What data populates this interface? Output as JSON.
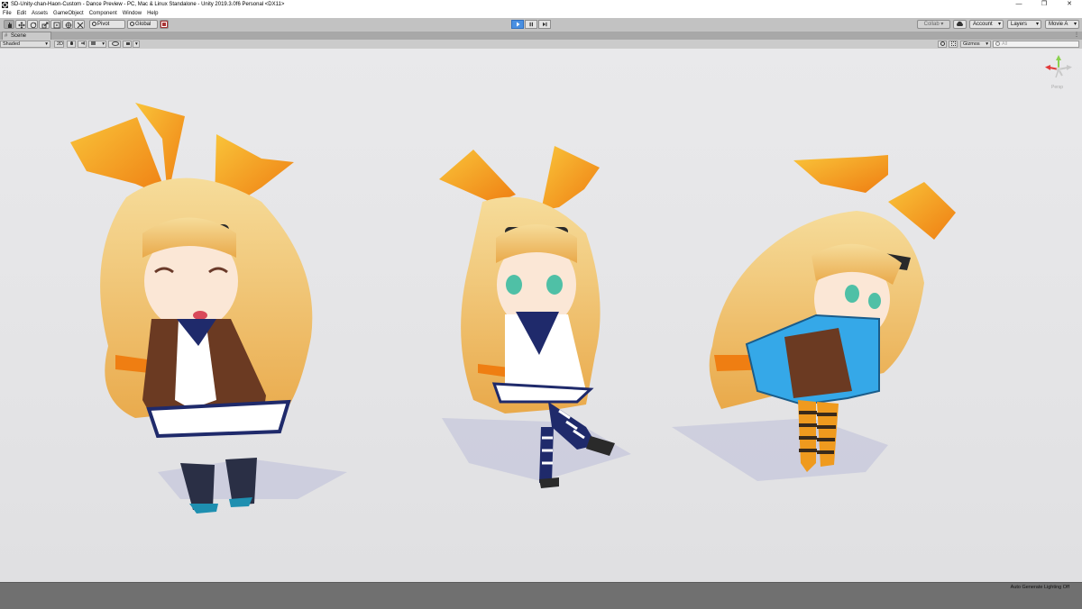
{
  "window": {
    "title": "SD-Unity-chan-Haon-Custom - Dance Preview - PC, Mac & Linux Standalone - Unity 2019.3.0f6 Personal <DX11>",
    "controls": [
      "—",
      "❐",
      "✕"
    ]
  },
  "menu": [
    "File",
    "Edit",
    "Assets",
    "GameObject",
    "Component",
    "Window",
    "Help"
  ],
  "toolbar": {
    "pivot_label": "Pivot",
    "global_label": "Global",
    "collab_label": "Collab ▾",
    "account_label": "Account",
    "layers_label": "Layers",
    "layout_label": "Movie A"
  },
  "scene_tab": {
    "label": "Scene",
    "menu": "⋮"
  },
  "scene_bar": {
    "shading": "Shaded",
    "mode_2d": "2D",
    "gizmos_label": "Gizmos",
    "search_placeholder": "All"
  },
  "gizmo": {
    "persp_label": "Persp"
  },
  "status": {
    "text": "Auto Generate Lighting Off"
  },
  "colors": {
    "accent": "#4a90e2",
    "viewport_bg": "#e6e6e8",
    "hair": "#f2c572",
    "ribbon": "#f29a1e",
    "uniform_navy": "#1f2a6b",
    "cardigan": "#6b3a22",
    "jacket_blue": "#35a8e8"
  }
}
